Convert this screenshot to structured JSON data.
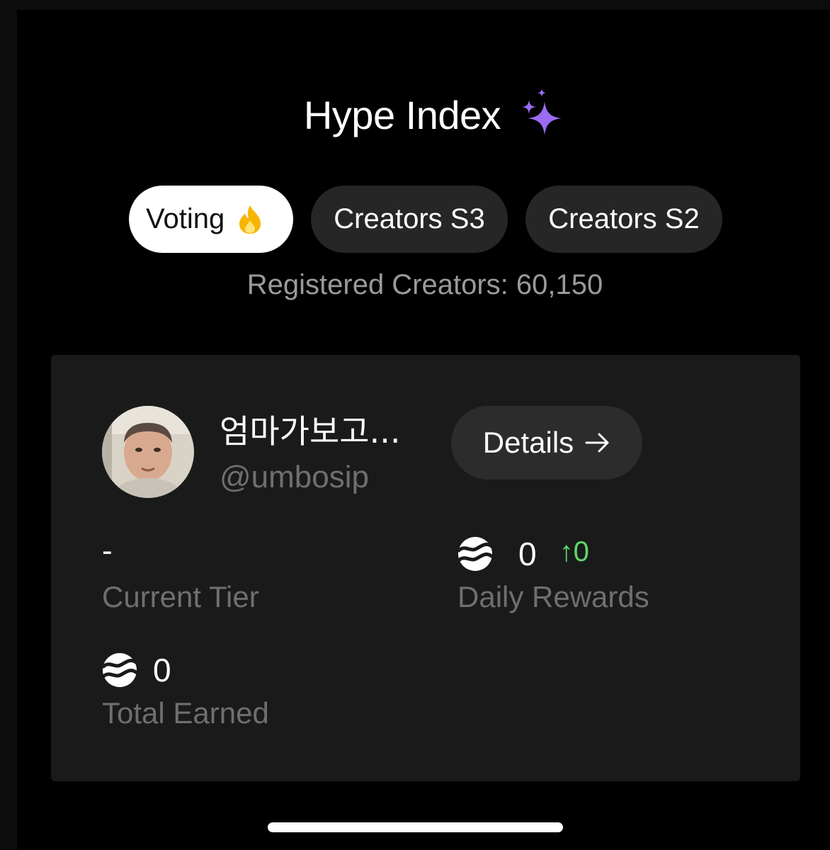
{
  "header": {
    "title": "Hype Index",
    "title_icon": "sparkles-icon",
    "accent_color": "#9b6cf2"
  },
  "tabs": [
    {
      "label": "Voting",
      "icon": "fire-icon",
      "active": true
    },
    {
      "label": "Creators S3",
      "active": false
    },
    {
      "label": "Creators S2",
      "active": false
    }
  ],
  "registered_text": "Registered Creators: 60,150",
  "profile": {
    "name": "엄마가보고...",
    "handle": "@umbosip",
    "details_label": "Details"
  },
  "stats": {
    "tier_value": "-",
    "tier_label": "Current Tier",
    "daily_value": "0",
    "daily_change": "↑0",
    "daily_label": "Daily Rewards",
    "total_value": "0",
    "total_label": "Total Earned"
  },
  "colors": {
    "background": "#000000",
    "card": "#1a1a1a",
    "positive": "#5fd86b",
    "muted_text": "#6f6f6f"
  }
}
